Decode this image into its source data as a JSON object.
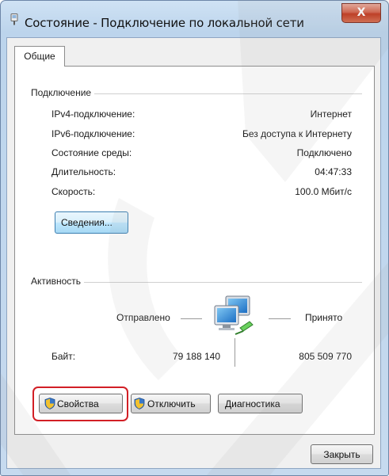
{
  "window": {
    "title": "Состояние - Подключение по локальной сети",
    "close_label": "X"
  },
  "tabs": [
    {
      "label": "Общие",
      "selected": true
    }
  ],
  "connection": {
    "group_label": "Подключение",
    "rows": [
      {
        "label": "IPv4-подключение:",
        "value": "Интернет"
      },
      {
        "label": "IPv6-подключение:",
        "value": "Без доступа к Интернету"
      },
      {
        "label": "Состояние среды:",
        "value": "Подключено"
      },
      {
        "label": "Длительность:",
        "value": "04:47:33"
      },
      {
        "label": "Скорость:",
        "value": "100.0 Мбит/с"
      }
    ],
    "details_button": "Сведения..."
  },
  "activity": {
    "group_label": "Активность",
    "sent_label": "Отправлено",
    "received_label": "Принято",
    "bytes_label": "Байт:",
    "bytes_sent": "79 188 140",
    "bytes_received": "805 509 770"
  },
  "buttons": {
    "properties": "Свойства",
    "disable": "Отключить",
    "diagnose": "Диагностика",
    "close": "Закрыть"
  },
  "colors": {
    "highlight": "#d21f26",
    "titlebar": "#c6daef",
    "close_button": "#c2371b"
  }
}
